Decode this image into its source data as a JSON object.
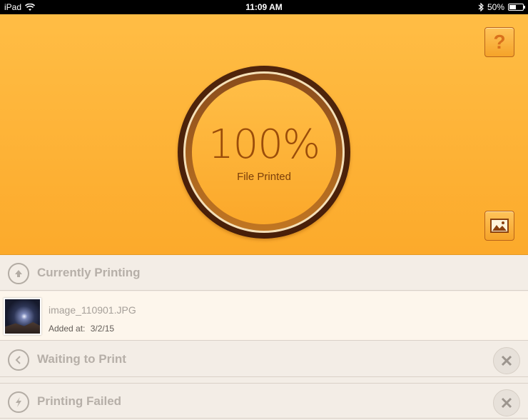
{
  "status_bar": {
    "device": "iPad",
    "time": "11:09 AM",
    "battery": "50%",
    "battery_level": 0.5,
    "icons": [
      "wifi-icon",
      "bluetooth-icon",
      "battery-icon"
    ]
  },
  "progress": {
    "percent_text": "100%",
    "label": "File Printed",
    "value": 1.0
  },
  "buttons": {
    "help": "?",
    "help_icon": "question-icon",
    "gallery_icon": "image-icon"
  },
  "sections": {
    "currently_printing": {
      "title": "Currently Printing",
      "icon": "upload-arrow-icon"
    },
    "waiting": {
      "title": "Waiting to Print",
      "icon": "back-arrow-icon"
    },
    "failed": {
      "title": "Printing Failed",
      "icon": "lightning-icon"
    }
  },
  "current_item": {
    "filename": "image_110901.JPG",
    "added_label": "Added at:",
    "added_date": "3/2/15"
  },
  "colors": {
    "accent": "#fcaa2b",
    "ring_dark": "#3a1404",
    "muted_text": "#b6afa8"
  }
}
